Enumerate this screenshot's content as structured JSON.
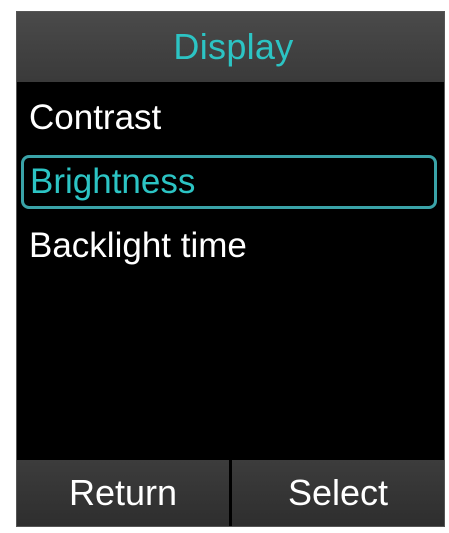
{
  "header": {
    "title": "Display"
  },
  "menu": {
    "items": [
      {
        "label": "Contrast",
        "selected": false
      },
      {
        "label": "Brightness",
        "selected": true
      },
      {
        "label": "Backlight time",
        "selected": false
      }
    ]
  },
  "softkeys": {
    "left_label": "Return",
    "right_label": "Select"
  },
  "colors": {
    "accent": "#2cc4c4",
    "background": "#000000",
    "bar": "#3a3a3a",
    "text": "#ffffff"
  }
}
